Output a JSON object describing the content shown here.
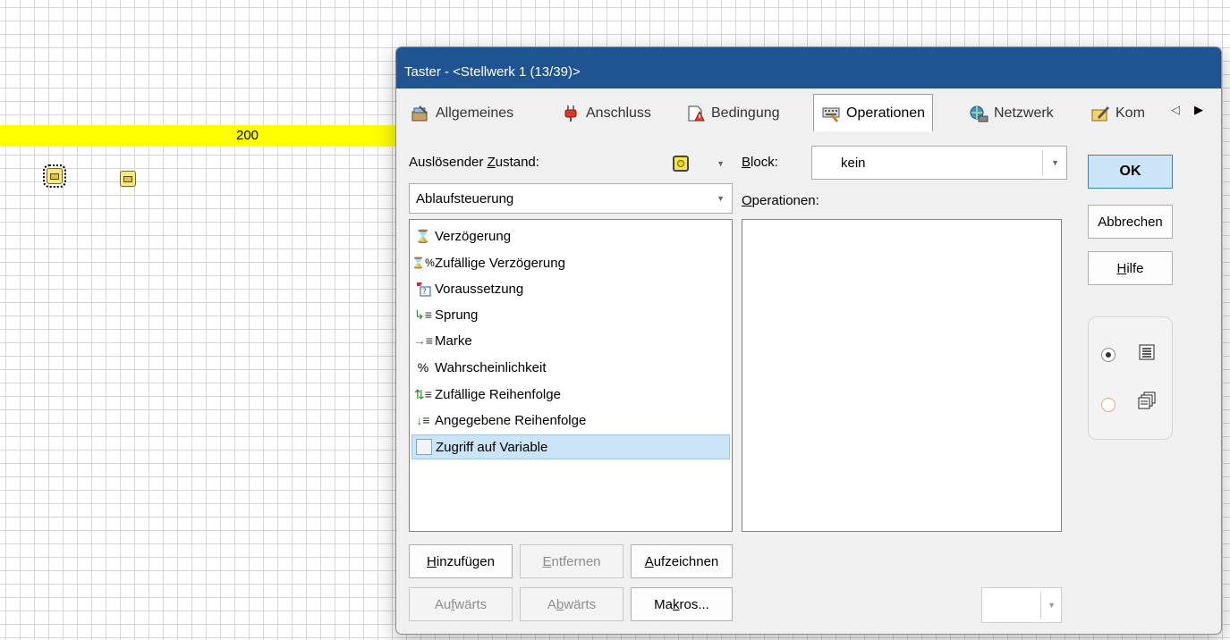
{
  "canvas": {
    "track_label": "200"
  },
  "dialog": {
    "title": "Taster - <Stellwerk 1 (13/39)>",
    "tabs": [
      {
        "label": "Allgemeines",
        "icon": "toolbox-icon"
      },
      {
        "label": "Anschluss",
        "icon": "plug-icon"
      },
      {
        "label": "Bedingung",
        "icon": "condition-icon"
      },
      {
        "label": "Operationen",
        "icon": "operations-icon",
        "active": true
      },
      {
        "label": "Netzwerk",
        "icon": "network-icon"
      },
      {
        "label": "Kom",
        "icon": "comment-icon"
      }
    ],
    "trigger_label_pre": "Auslösender ",
    "trigger_label_key": "Z",
    "trigger_label_post": "ustand:",
    "category_value": "Ablaufsteuerung",
    "block_label_key": "B",
    "block_label_post": "lock:",
    "block_value": "kein",
    "operations_label_key": "O",
    "operations_label_post": "perationen:",
    "available_ops": [
      {
        "label": "Verzögerung",
        "icon": "hourglass-icon"
      },
      {
        "label": "Zufällige Verzögerung",
        "icon": "random-delay-icon"
      },
      {
        "label": "Voraussetzung",
        "icon": "prerequisite-icon"
      },
      {
        "label": "Sprung",
        "icon": "jump-icon"
      },
      {
        "label": "Marke",
        "icon": "marker-icon"
      },
      {
        "label": "Wahrscheinlichkeit",
        "icon": "percent-icon"
      },
      {
        "label": "Zufällige Reihenfolge",
        "icon": "random-order-icon"
      },
      {
        "label": "Angegebene Reihenfolge",
        "icon": "given-order-icon"
      },
      {
        "label": "Zugriff auf Variable",
        "icon": "variable-icon",
        "selected": true
      }
    ],
    "buttons": {
      "ok": "OK",
      "cancel": "Abbrechen",
      "help_key": "H",
      "help_post": "ilfe",
      "add_key": "H",
      "add_post": "inzufügen",
      "remove_key": "E",
      "remove_post": "ntfernen",
      "record_key": "A",
      "record_post": "ufzeichnen",
      "up_pre": "Au",
      "up_key": "f",
      "up_post": "wärts",
      "down_pre": "A",
      "down_key": "b",
      "down_post": "wärts",
      "macros_pre": "Ma",
      "macros_key": "k",
      "macros_post": "ros..."
    },
    "colors": {
      "titlebar": "#1f5392",
      "track": "#ffff00",
      "selection": "#cce4f7"
    }
  }
}
